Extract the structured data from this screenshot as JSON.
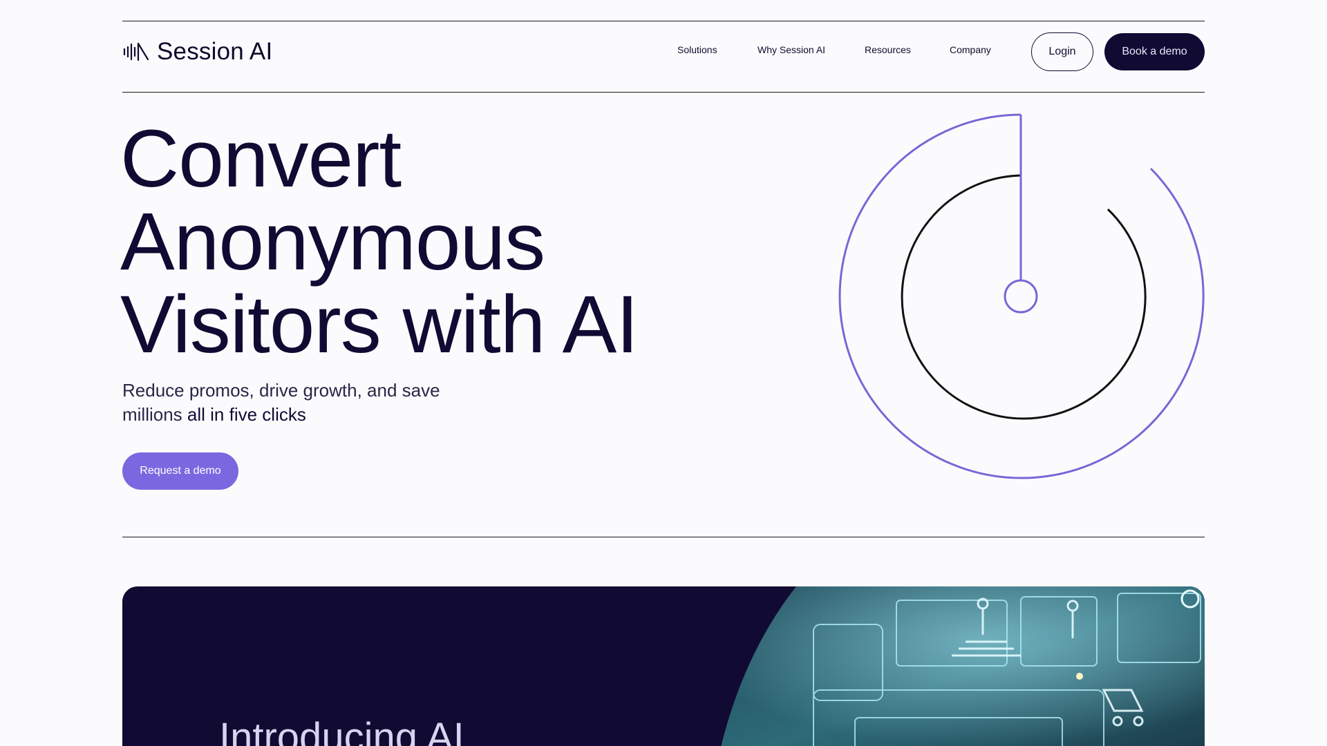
{
  "brand": {
    "name": "Session AI",
    "logo_icon": "soundwave-logo-icon"
  },
  "nav": {
    "links": [
      "Solutions",
      "Why Session AI",
      "Resources",
      "Company"
    ],
    "login_label": "Login",
    "demo_label": "Book a demo"
  },
  "hero": {
    "title_lines": [
      "Convert",
      "Anonymous",
      "Visitors with AI"
    ],
    "subtitle_part1": "Reduce promos, drive growth, and save millions ",
    "subtitle_part2": "all in five clicks",
    "cta_label": "Request a demo"
  },
  "feature_card": {
    "title": "Introducing AI",
    "image_icon": "ai-commerce-illustration"
  },
  "colors": {
    "background": "#fbfbfe",
    "primary_dark": "#110a33",
    "accent_purple": "#7b68e0",
    "circle_purple": "#7a66d6"
  }
}
